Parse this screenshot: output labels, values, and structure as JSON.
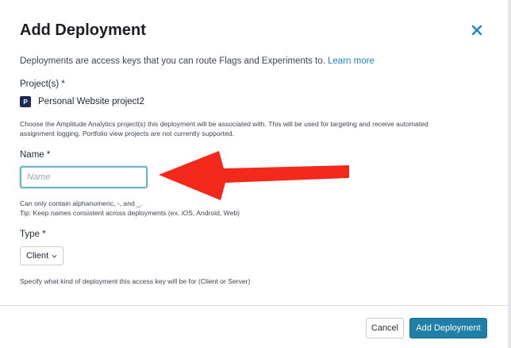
{
  "dialog": {
    "title": "Add Deployment",
    "intro_text": "Deployments are access keys that you can route Flags and Experiments to.",
    "learn_more": "Learn more"
  },
  "projects": {
    "label": "Project(s) *",
    "badge": "P",
    "selected": "Personal Website project2",
    "help_line1": "Choose the Amplitude Analytics project(s) this deployment will be associated with. This will be used for targeting and receive automated",
    "help_line2": "assignment logging. Portfolio view projects are not currently supported."
  },
  "name": {
    "label": "Name *",
    "placeholder": "Name",
    "value": "",
    "help_line1": "Can only contain alphanumeric, -, and _.",
    "help_line2": "Tip: Keep names consistent across deployments (ex. iOS, Android, Web)"
  },
  "type": {
    "label": "Type *",
    "selected": "Client",
    "help": "Specify what kind of deployment this access key will be for (Client or Server)"
  },
  "footer": {
    "cancel_label": "Cancel",
    "submit_label": "Add Deployment"
  },
  "colors": {
    "primary": "#1f7fa6",
    "link": "#1e86c4",
    "annotation_arrow": "#f2291b",
    "project_badge": "#1d2b5c"
  },
  "icons": {
    "close": "close-icon",
    "chevron": "chevron-down-icon",
    "annotation": "arrow-left-annotation"
  }
}
